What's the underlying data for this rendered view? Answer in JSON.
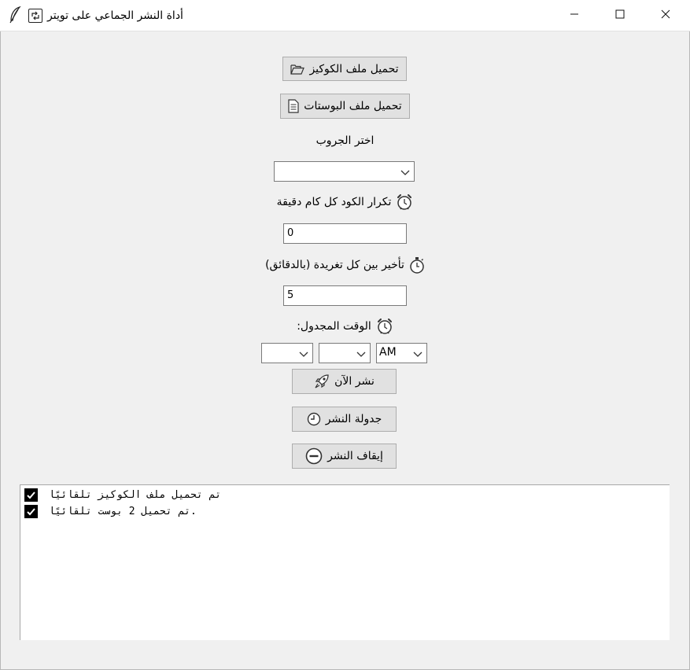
{
  "window": {
    "title": "أداة النشر الجماعي على تويتر",
    "icon": "feather-icon",
    "controls": {
      "minimize_icon": "minimize-icon",
      "maximize_icon": "maximize-icon",
      "close_icon": "close-icon"
    }
  },
  "buttons": {
    "load_cookies": {
      "label": "تحميل ملف الكوكيز",
      "icon": "folder-open-icon"
    },
    "load_posts": {
      "label": "تحميل ملف البوستات",
      "icon": "document-icon"
    },
    "post_now": {
      "label": "نشر الآن",
      "icon": "rocket-icon"
    },
    "schedule": {
      "label": "جدولة النشر",
      "icon": "clock-icon"
    },
    "stop": {
      "label": "إيقاف النشر",
      "icon": "stop-icon"
    }
  },
  "group": {
    "label": "اختر الجروب",
    "selected": ""
  },
  "repeat": {
    "label": "تكرار الكود كل كام دقيقة",
    "icon": "alarm-clock-icon",
    "value": "0"
  },
  "delay": {
    "label": "تأخير بين كل تغريدة (بالدقائق)",
    "icon": "stopwatch-icon",
    "value": "5"
  },
  "schedule_time": {
    "label": ":الوقت المجدول",
    "icon": "alarm-clock-icon",
    "hour": "",
    "minute": "",
    "ampm": "AM"
  },
  "log": {
    "lines": [
      {
        "icon": "check-icon",
        "text": "تم تحميل ملف الكوكيز تلقائيًا"
      },
      {
        "icon": "check-icon",
        "text": "تم تحميل 2 بوست تلقائيًا."
      }
    ]
  },
  "colors": {
    "window_bg": "#f0f0f0",
    "button_bg": "#e1e1e1",
    "button_border": "#adadad",
    "field_border": "#7a7a7a"
  }
}
